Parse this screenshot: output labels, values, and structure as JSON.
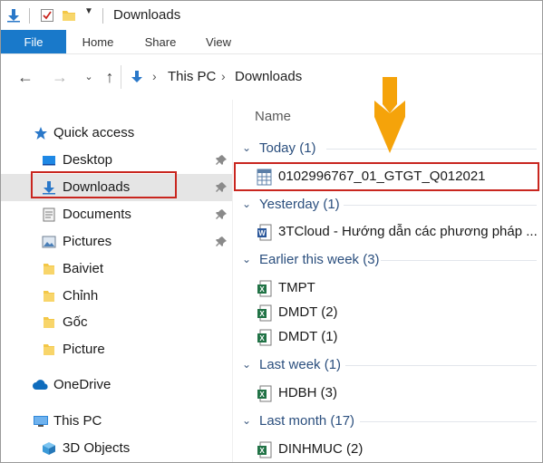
{
  "window": {
    "title": "Downloads"
  },
  "ribbon": {
    "tabs": [
      {
        "label": "File"
      },
      {
        "label": "Home"
      },
      {
        "label": "Share"
      },
      {
        "label": "View"
      }
    ]
  },
  "address": {
    "crumbs": [
      "This PC",
      "Downloads"
    ]
  },
  "nav": {
    "items": [
      {
        "label": "Quick access",
        "icon": "star-icon"
      },
      {
        "label": "Desktop",
        "icon": "desktop-icon",
        "pinned": true
      },
      {
        "label": "Downloads",
        "icon": "download-arrow-icon",
        "pinned": true,
        "selected": true
      },
      {
        "label": "Documents",
        "icon": "documents-icon",
        "pinned": true
      },
      {
        "label": "Pictures",
        "icon": "pictures-icon",
        "pinned": true
      },
      {
        "label": "Baiviet",
        "icon": "folder-icon"
      },
      {
        "label": "Chỉnh",
        "icon": "folder-icon"
      },
      {
        "label": "Gốc",
        "icon": "folder-icon"
      },
      {
        "label": "Picture",
        "icon": "folder-icon"
      },
      {
        "label": "OneDrive",
        "icon": "cloud-icon"
      },
      {
        "label": "This PC",
        "icon": "computer-icon"
      },
      {
        "label": "3D Objects",
        "icon": "cube-icon"
      }
    ]
  },
  "content": {
    "column_header": "Name",
    "groups": [
      {
        "label": "Today (1)",
        "files": [
          {
            "name": "0102996767_01_GTGT_Q012021",
            "icon": "table-file-icon"
          }
        ]
      },
      {
        "label": "Yesterday (1)",
        "files": [
          {
            "name": "3TCloud - Hướng dẫn các phương pháp ...",
            "icon": "word-file-icon"
          }
        ]
      },
      {
        "label": "Earlier this week (3)",
        "files": [
          {
            "name": "TMPT",
            "icon": "excel-file-icon"
          },
          {
            "name": "DMDT (2)",
            "icon": "excel-file-icon"
          },
          {
            "name": "DMDT (1)",
            "icon": "excel-file-icon"
          }
        ]
      },
      {
        "label": "Last week (1)",
        "files": [
          {
            "name": "HDBH (3)",
            "icon": "excel-file-icon"
          }
        ]
      },
      {
        "label": "Last month (17)",
        "files": [
          {
            "name": "DINHMUC (2)",
            "icon": "excel-file-icon"
          }
        ]
      }
    ]
  },
  "colors": {
    "accent": "#1979ca",
    "highlight": "#c9261f",
    "arrow": "#f5a30a",
    "group_text": "#2b4f7e",
    "selected_bg": "#e5e5e5"
  }
}
